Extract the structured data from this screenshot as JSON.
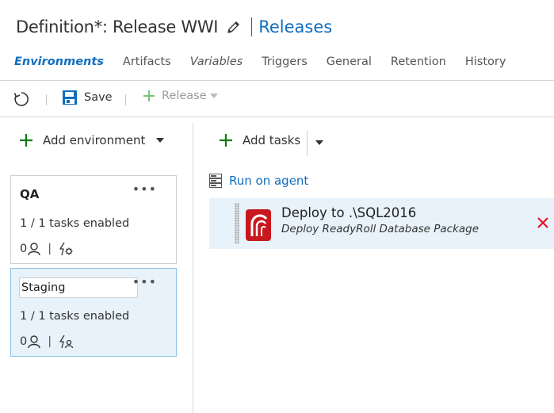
{
  "header": {
    "title": "Definition*: Release WWI",
    "releases_link": "Releases"
  },
  "tabs": [
    {
      "label": "Environments",
      "active": true
    },
    {
      "label": "Artifacts"
    },
    {
      "label": "Variables"
    },
    {
      "label": "Triggers"
    },
    {
      "label": "General"
    },
    {
      "label": "Retention"
    },
    {
      "label": "History"
    }
  ],
  "toolbar": {
    "refresh_icon": "refresh-icon",
    "save_label": "Save",
    "release_label": "Release"
  },
  "left_panel": {
    "add_environment_label": "Add environment",
    "environments": [
      {
        "name": "QA",
        "tasks": "1 / 1 tasks enabled",
        "approvers": "0",
        "selected": false
      },
      {
        "name": "Staging",
        "tasks": "1 / 1 tasks enabled",
        "approvers": "0",
        "selected": true,
        "editing": true
      }
    ]
  },
  "right_panel": {
    "add_tasks_label": "Add tasks",
    "phase_label": "Run on agent",
    "tasks": [
      {
        "title": "Deploy to .\\SQL2016",
        "subtitle": "Deploy ReadyRoll Database Package"
      }
    ]
  },
  "colors": {
    "accent": "#106ebe",
    "selected_bg": "#e7f2fa",
    "add_green": "#107c10",
    "remove_red": "#e81123",
    "task_icon_red": "#c8181e"
  }
}
